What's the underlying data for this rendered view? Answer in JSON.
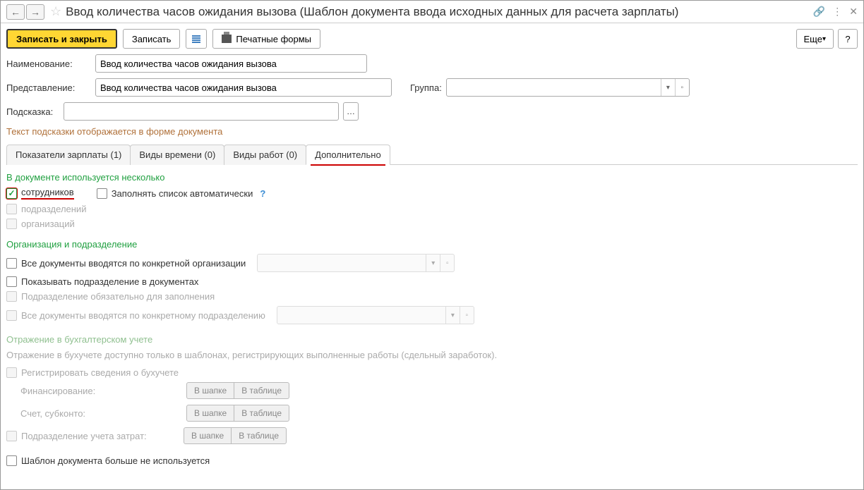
{
  "header": {
    "title": "Ввод количества часов ожидания вызова (Шаблон документа ввода исходных данных для расчета зарплаты)"
  },
  "toolbar": {
    "save_close": "Записать и закрыть",
    "save": "Записать",
    "print": "Печатные формы",
    "more": "Еще",
    "help": "?"
  },
  "form": {
    "name_label": "Наименование:",
    "name_value": "Ввод количества часов ожидания вызова",
    "repr_label": "Представление:",
    "repr_value": "Ввод количества часов ожидания вызова",
    "group_label": "Группа:",
    "hint_label": "Подсказка:",
    "hint_help": "Текст подсказки отображается в форме документа"
  },
  "tabs": {
    "t1": "Показатели зарплаты (1)",
    "t2": "Виды времени (0)",
    "t3": "Виды работ (0)",
    "t4": "Дополнительно"
  },
  "sections": {
    "multi": {
      "title": "В документе используется несколько",
      "employees": "сотрудников",
      "autofill": "Заполнять список автоматически",
      "departments": "подразделений",
      "organizations": "организаций"
    },
    "org": {
      "title": "Организация и подразделение",
      "by_org": "Все документы вводятся по конкретной организации",
      "show_dept": "Показывать подразделение в документах",
      "dept_required": "Подразделение обязательно для заполнения",
      "by_dept": "Все документы вводятся по конкретному подразделению"
    },
    "acct": {
      "title": "Отражение в бухгалтерском учете",
      "note": "Отражение в бухучете доступно только в шаблонах, регистрирующих выполненные работы (сдельный заработок).",
      "register": "Регистрировать сведения о бухучете",
      "financing": "Финансирование:",
      "account": "Счет, субконто:",
      "cost_dept": "Подразделение учета затрат:",
      "in_header": "В шапке",
      "in_table": "В таблице"
    },
    "not_used": "Шаблон документа больше не используется"
  }
}
